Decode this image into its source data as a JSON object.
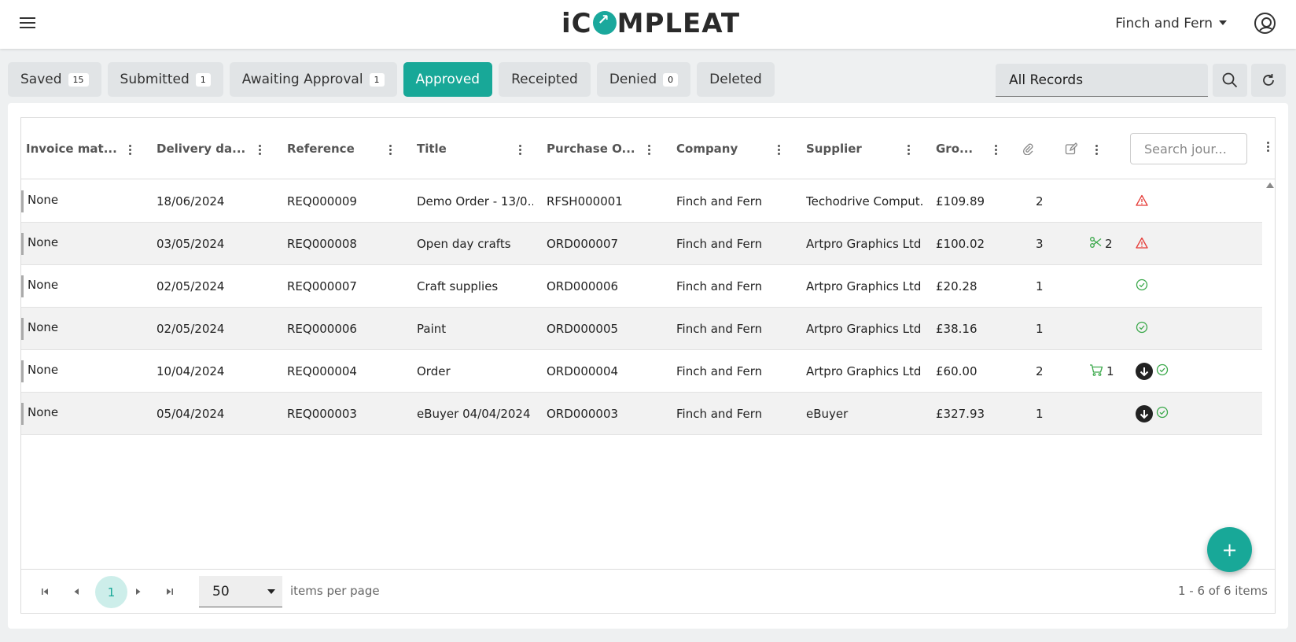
{
  "header": {
    "logo_text_before": "iC",
    "logo_text_after": "MPLEAT",
    "organisation": "Finch and Fern"
  },
  "tabs": [
    {
      "label": "Saved",
      "count": "15"
    },
    {
      "label": "Submitted",
      "count": "1"
    },
    {
      "label": "Awaiting Approval",
      "count": "1"
    },
    {
      "label": "Approved",
      "count": ""
    },
    {
      "label": "Receipted",
      "count": ""
    },
    {
      "label": "Denied",
      "count": "0"
    },
    {
      "label": "Deleted",
      "count": ""
    }
  ],
  "active_tab": "Approved",
  "filter": {
    "records": "All Records"
  },
  "columns": {
    "invoice": "Invoice mat...",
    "delivery": "Delivery da...",
    "reference": "Reference",
    "title": "Title",
    "purchase_order": "Purchase O...",
    "company": "Company",
    "supplier": "Supplier",
    "gross": "Gro...",
    "attachments_icon": "paperclip-icon",
    "notes_icon": "edit-icon"
  },
  "journal_search": {
    "placeholder": "Search jour..."
  },
  "rows": [
    {
      "invoice": "None",
      "delivery": "18/06/2024",
      "reference": "REQ000009",
      "title": "Demo Order - 13/0...",
      "po": "RFSH000001",
      "company": "Finch and Fern",
      "supplier": "Techodrive Comput...",
      "gross": "£109.89",
      "attachments": "2",
      "extra": "",
      "extra_icon": "",
      "status": [
        "warning"
      ]
    },
    {
      "invoice": "None",
      "delivery": "03/05/2024",
      "reference": "REQ000008",
      "title": "Open day crafts",
      "po": "ORD000007",
      "company": "Finch and Fern",
      "supplier": "Artpro Graphics Ltd",
      "gross": "£100.02",
      "attachments": "3",
      "extra": "2",
      "extra_icon": "scissors",
      "status": [
        "warning"
      ]
    },
    {
      "invoice": "None",
      "delivery": "02/05/2024",
      "reference": "REQ000007",
      "title": "Craft supplies",
      "po": "ORD000006",
      "company": "Finch and Fern",
      "supplier": "Artpro Graphics Ltd",
      "gross": "£20.28",
      "attachments": "1",
      "extra": "",
      "extra_icon": "",
      "status": [
        "check"
      ]
    },
    {
      "invoice": "None",
      "delivery": "02/05/2024",
      "reference": "REQ000006",
      "title": "Paint",
      "po": "ORD000005",
      "company": "Finch and Fern",
      "supplier": "Artpro Graphics Ltd",
      "gross": "£38.16",
      "attachments": "1",
      "extra": "",
      "extra_icon": "",
      "status": [
        "check"
      ]
    },
    {
      "invoice": "None",
      "delivery": "10/04/2024",
      "reference": "REQ000004",
      "title": "Order",
      "po": "ORD000004",
      "company": "Finch and Fern",
      "supplier": "Artpro Graphics Ltd",
      "gross": "£60.00",
      "attachments": "2",
      "extra": "1",
      "extra_icon": "cart",
      "status": [
        "download",
        "check"
      ]
    },
    {
      "invoice": "None",
      "delivery": "05/04/2024",
      "reference": "REQ000003",
      "title": "eBuyer 04/04/2024",
      "po": "ORD000003",
      "company": "Finch and Fern",
      "supplier": "eBuyer",
      "gross": "£327.93",
      "attachments": "1",
      "extra": "",
      "extra_icon": "",
      "status": [
        "download",
        "check"
      ]
    }
  ],
  "pager": {
    "current_page": "1",
    "per_page": "50",
    "per_page_label": "items per page",
    "range": "1 - 6 of 6 items"
  },
  "fab": {
    "label": "+"
  },
  "colors": {
    "accent": "#18a898",
    "warning": "#e53935",
    "success": "#3aa84a"
  }
}
